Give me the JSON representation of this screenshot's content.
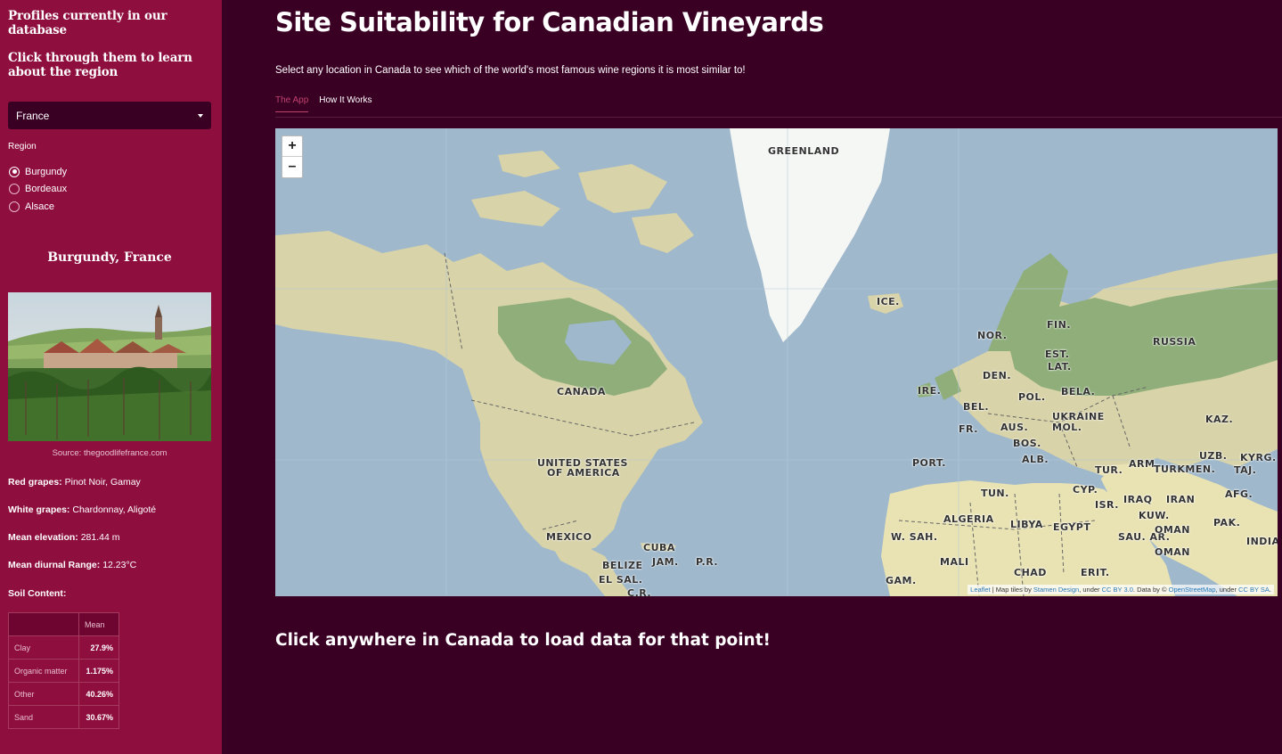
{
  "sidebar": {
    "heading": "Profiles currently in our database",
    "subheading": "Click through them to learn about the region",
    "country_select": "France",
    "region_label": "Region",
    "regions": [
      {
        "label": "Burgundy",
        "checked": true
      },
      {
        "label": "Bordeaux",
        "checked": false
      },
      {
        "label": "Alsace",
        "checked": false
      }
    ],
    "profile_title": "Burgundy, France",
    "photo_source": "Source: thegoodlifefrance.com",
    "facts": [
      {
        "label": "Red grapes:",
        "value": "Pinot Noir, Gamay"
      },
      {
        "label": "White grapes:",
        "value": "Chardonnay, Aligoté"
      },
      {
        "label": "Mean elevation:",
        "value": "281.44 m"
      },
      {
        "label": "Mean diurnal Range:",
        "value": "12.23°C"
      }
    ],
    "soil_label": "Soil Content:",
    "soil_table": {
      "header": "Mean",
      "rows": [
        {
          "name": "Clay",
          "value": "27.9%"
        },
        {
          "name": "Organic matter",
          "value": "1.175%"
        },
        {
          "name": "Other",
          "value": "40.26%"
        },
        {
          "name": "Sand",
          "value": "30.67%"
        }
      ]
    }
  },
  "main": {
    "title": "Site Suitability for Canadian Vineyards",
    "subtitle": "Select any location in Canada to see which of the world's most famous wine regions it is most similar to!",
    "tabs": [
      {
        "label": "The App",
        "active": true
      },
      {
        "label": "How It Works",
        "active": false
      }
    ],
    "map": {
      "zoom_in": "+",
      "zoom_out": "–",
      "labels": [
        "GREENLAND",
        "ICE.",
        "CANADA",
        "UNITED STATES",
        "OF AMERICA",
        "MEXICO",
        "CUBA",
        "JAM.",
        "P.R.",
        "BELIZE",
        "EL SAL.",
        "C.R.",
        "NOR.",
        "FIN.",
        "RUSSIA",
        "EST.",
        "LAT.",
        "DEN.",
        "IRE.",
        "POL.",
        "BELA.",
        "BEL.",
        "UKRAINE",
        "MOL.",
        "FR.",
        "AUS.",
        "KAZ.",
        "BOS.",
        "ALB.",
        "PORT.",
        "TUR.",
        "ARM.",
        "UZB.",
        "KYRG.",
        "TURKMEN.",
        "TAJ.",
        "TUN.",
        "CYP.",
        "ISR.",
        "IRAQ",
        "IRAN",
        "AFG.",
        "KUW.",
        "ALGERIA",
        "LIBYA",
        "EGYPT",
        "SAU. AR.",
        "OMAN",
        "PAK.",
        "W. SAH.",
        "INDIA",
        "MALI",
        "CHAD",
        "ERIT.",
        "GAM."
      ],
      "attribution_leaflet": "Leaflet",
      "attribution_text1": " | Map tiles by ",
      "attribution_stamen": "Stamen Design",
      "attribution_text2": ", under ",
      "attribution_ccby": "CC BY 3.0",
      "attribution_text3": ". Data by © ",
      "attribution_osm": "OpenStreetMap",
      "attribution_text4": ", under ",
      "attribution_ccbysa": "CC BY SA",
      "attribution_end": "."
    },
    "cta": "Click anywhere in Canada to load data for that point!"
  }
}
